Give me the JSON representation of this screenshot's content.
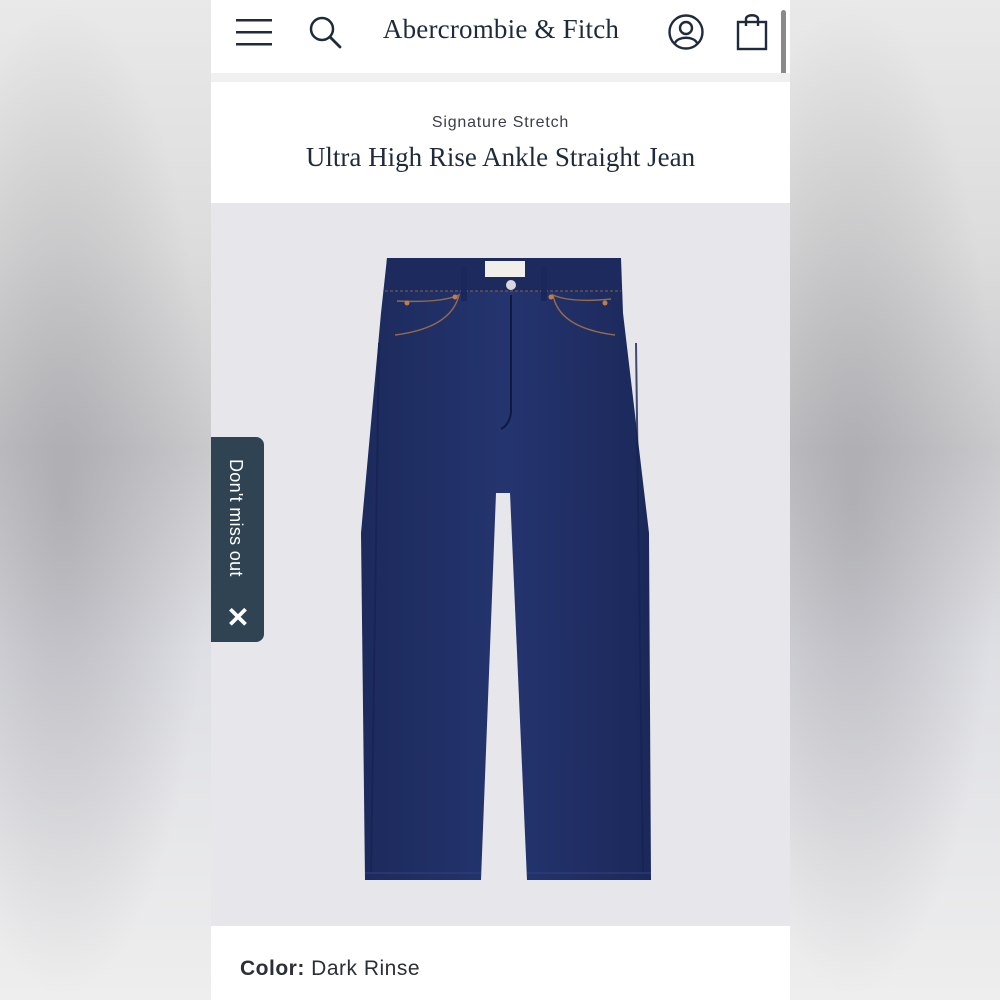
{
  "header": {
    "brand": "Abercrombie & Fitch",
    "icons": [
      "menu-icon",
      "search-icon",
      "account-icon",
      "shopping-bag-icon"
    ]
  },
  "product": {
    "collection": "Signature Stretch",
    "name": "Ultra High Rise Ankle Straight Jean",
    "image_alt_icon": "jeans-image"
  },
  "promo_tab": {
    "label": "Don't miss out",
    "close_icon": "close-icon"
  },
  "color_selector": {
    "label": "Color:",
    "value": "Dark Rinse"
  },
  "colors": {
    "brand_navy": "#1f2a3c",
    "promo_bg": "#2f4353",
    "denim": "#1f2d63",
    "image_bg": "#e7e6ea"
  }
}
